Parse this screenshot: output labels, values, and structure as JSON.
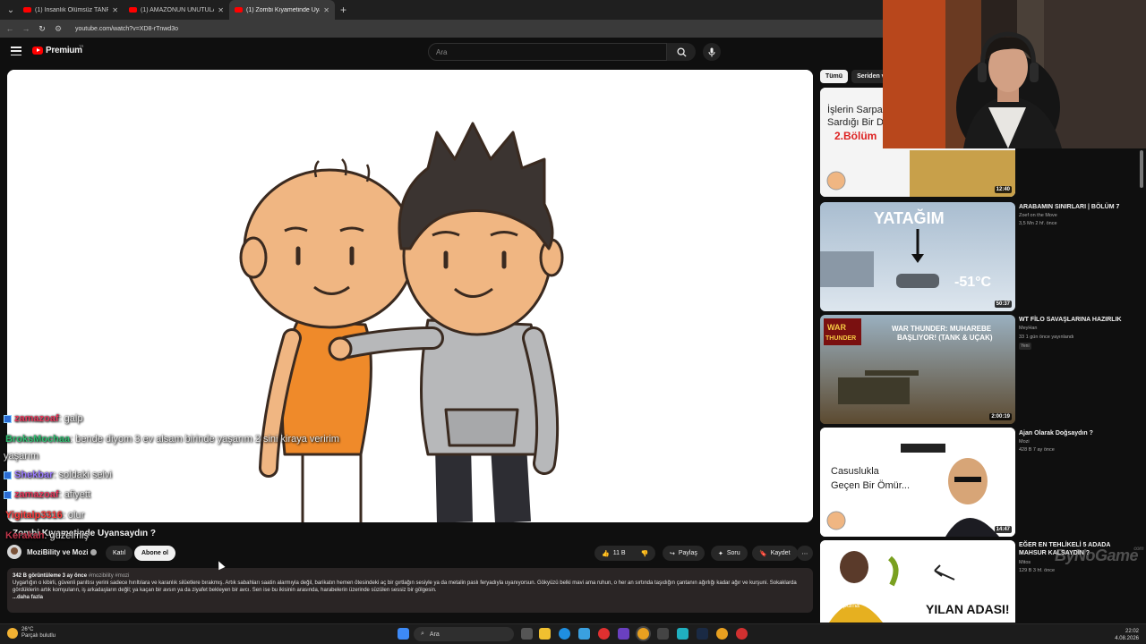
{
  "browser": {
    "tabs": [
      {
        "label": "(1) İnsanlık Ölümsüz TANRI Kra",
        "active": false
      },
      {
        "label": "(1) AMAZONUN UNUTULAN KA",
        "active": false
      },
      {
        "label": "(1) Zombi Kıyametinde Uyansa",
        "active": true
      }
    ],
    "url": "youtube.com/watch?v=XD8-rTnwd3o"
  },
  "header": {
    "logo_text": "Premium",
    "logo_sup": "TR",
    "search_placeholder": "Ara"
  },
  "chat": [
    {
      "user": "zamazoaf",
      "user_color": "#e8385c",
      "message": ": galp",
      "badge": true
    },
    {
      "user": "BroksMochaa",
      "user_color": "#2fbf71",
      "message": ": bende diyom 3 ev alsam birinde yaşarım 2 sini kiraya veririm",
      "badge": false
    },
    {
      "user": "",
      "user_color": "#ffffff",
      "message": "yaşarım",
      "badge": false
    },
    {
      "user": "Shekbar",
      "user_color": "#9b7bff",
      "message": ": soldaki selvi",
      "badge": true
    },
    {
      "user": "zamazoaf",
      "user_color": "#e8385c",
      "message": ": afiyett",
      "badge": true
    },
    {
      "user": "Yigitalp3316",
      "user_color": "#ff3b3b",
      "message": ": olur",
      "badge": false
    },
    {
      "user": "Kerakah",
      "user_color": "#c0364b",
      "message": ": güzelmiş",
      "badge": false
    }
  ],
  "video": {
    "title": "Zombi Kıyametinde Uyansaydın ?",
    "channel": "MoziBility ve Mozi",
    "join_label": "Katıl",
    "subscribe_label": "Abone ol",
    "likes": "11 B",
    "share_label": "Paylaş",
    "ask_label": "Soru",
    "save_label": "Kaydet",
    "stats": "342 B görüntüleme  3 ay önce",
    "tags": "#mozibility #mozi",
    "description": "Uygarlığın o kibirli, güvenli parıltısı yerini sadece hırıltılara ve karanlık silüetlere bırakmış. Artık sabahları saatin alarmıyla değil, barikatın hemen ötesindeki aç bir gırtlağın sesiyle ya da metalin paslı feryadıyla uyanıyorsun. Gökyüzü belki mavi ama ruhun, o her an sırtında taşıdığın çantanın ağırlığı kadar ağır ve kurşuni. Sokaklarda gördüklerin artık komşuların, iş arkadaşların değil; ya kaçan bir avsın ya da ziyafet bekleyen bir avcı. Sen ise bu ikisinin arasında, harabelerin üzerinde süzülen sessiz bir gölgesin.",
    "more_label": "...daha fazla"
  },
  "sidebar": {
    "chips": [
      {
        "label": "Tümü",
        "selected": true
      },
      {
        "label": "Seriden v",
        "selected": false
      }
    ],
    "videos": [
      {
        "title": "",
        "channel": "",
        "meta": "",
        "duration": "12:40",
        "thumb_text": "İşlerin Sarpa Sardığı Bir D 2.Bölüm"
      },
      {
        "title": "ARABAMIN SINIRLARI | BÖLÜM 7",
        "channel": "Zoef on the Move",
        "meta": "3,5 Mn  2 hf. önce",
        "duration": "50:37",
        "thumb_text": "YATAĞIM",
        "thumb_temp": "-51°C"
      },
      {
        "title": "WT FİLO SAVAŞLARINA HAZIRLIK",
        "channel": "MeyHan",
        "meta": "33  1 gün önce yayınlandı",
        "duration": "2:00:19",
        "badge": "Yeni",
        "thumb_text": "WAR THUNDER: MUHAREBE BAŞLIYOR! (TANK & UÇAK)",
        "thumb_logo": "WAR THUNDER"
      },
      {
        "title": "Ajan Olarak Doğsaydın ?",
        "channel": "Mozi",
        "meta": "428 B  7 ay önce",
        "duration": "14:47",
        "thumb_text": "Casuslukla Geçen Bir Ömür..."
      },
      {
        "title": "EĞER EN TEHLİKELİ 5 ADADA MAHSUR KALSAYDIN ?",
        "channel": "Mitos",
        "meta": "129 B  3 hf. önce",
        "duration": "",
        "thumb_text": "YILAN ADASI!",
        "thumb_name": "purna"
      }
    ]
  },
  "watermark": {
    "text": "ByNoGame",
    "sub": "com"
  },
  "taskbar": {
    "temp": "26°C",
    "weather": "Parçalı bulutlu",
    "search_label": "Ara",
    "time": "22:02",
    "date": "4.08.2026"
  }
}
